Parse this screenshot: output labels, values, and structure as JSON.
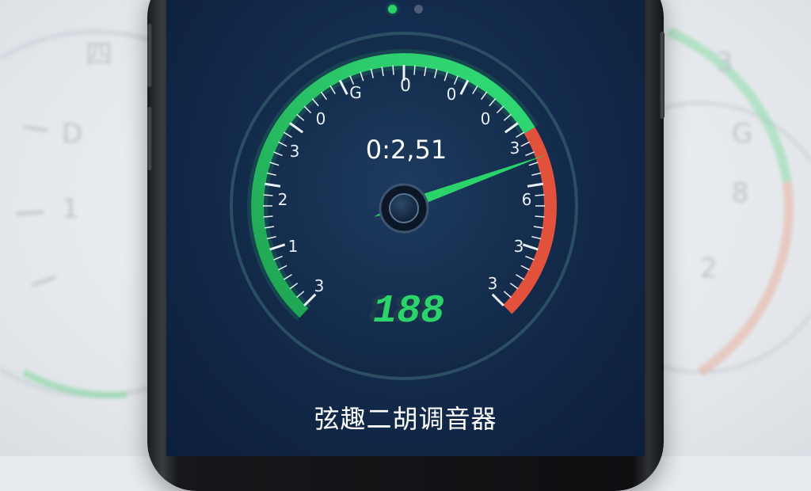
{
  "pager": {
    "page_count": 2,
    "active_index": 0
  },
  "gauge": {
    "scale_labels_left": [
      "3",
      "1",
      "2",
      "3",
      "0",
      "G"
    ],
    "scale_labels_top": [
      "0",
      "0",
      "0"
    ],
    "scale_labels_right": [
      "3",
      "6",
      "3",
      "3"
    ],
    "reading": "0:2,51",
    "digital_readout": "188",
    "needle_level_percent": 76
  },
  "app": {
    "title": "弦趣二胡调音器"
  },
  "colors": {
    "green": "#2bd46b",
    "red": "#e2513c",
    "bezel": "#2c4e64",
    "screen_bg": "#132b4d"
  },
  "background_gauges": {
    "left_labels": [
      "四",
      "D",
      "1"
    ],
    "right_labels": [
      "3",
      "G",
      "8",
      "2"
    ]
  }
}
